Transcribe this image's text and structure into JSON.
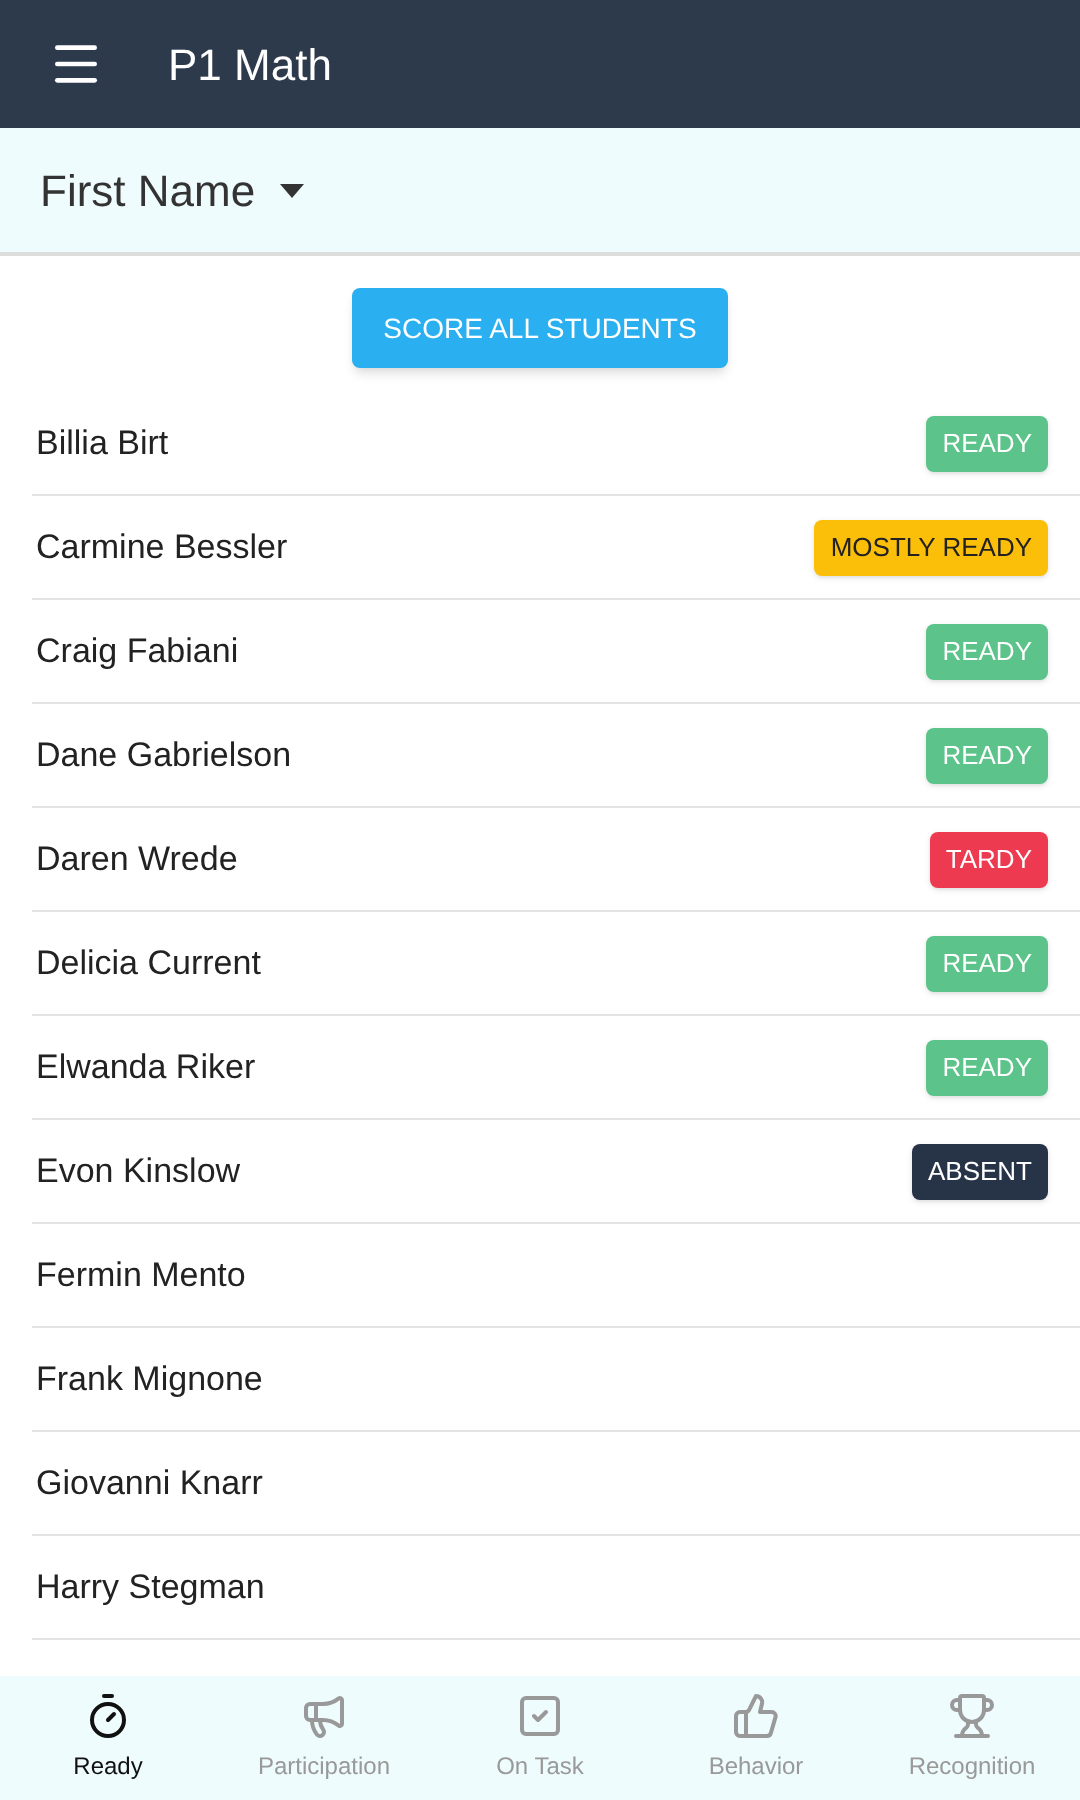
{
  "app_bar": {
    "title": "P1 Math"
  },
  "sort": {
    "label": "First Name"
  },
  "score_button": "SCORE ALL STUDENTS",
  "students": [
    {
      "name": "Billia Birt",
      "status": {
        "label": "READY",
        "kind": "ready"
      }
    },
    {
      "name": "Carmine Bessler",
      "status": {
        "label": "MOSTLY READY",
        "kind": "mostly"
      }
    },
    {
      "name": "Craig Fabiani",
      "status": {
        "label": "READY",
        "kind": "ready"
      }
    },
    {
      "name": "Dane Gabrielson",
      "status": {
        "label": "READY",
        "kind": "ready"
      }
    },
    {
      "name": "Daren Wrede",
      "status": {
        "label": "TARDY",
        "kind": "tardy"
      }
    },
    {
      "name": "Delicia Current",
      "status": {
        "label": "READY",
        "kind": "ready"
      }
    },
    {
      "name": "Elwanda Riker",
      "status": {
        "label": "READY",
        "kind": "ready"
      }
    },
    {
      "name": "Evon Kinslow",
      "status": {
        "label": "ABSENT",
        "kind": "absent"
      }
    },
    {
      "name": "Fermin Mento"
    },
    {
      "name": "Frank Mignone"
    },
    {
      "name": "Giovanni Knarr"
    },
    {
      "name": "Harry Stegman"
    }
  ],
  "bottom_nav": [
    {
      "label": "Ready",
      "kind": "timer",
      "selected": true
    },
    {
      "label": "Participation",
      "kind": "megaphone",
      "selected": false
    },
    {
      "label": "On Task",
      "kind": "checkbox",
      "selected": false
    },
    {
      "label": "Behavior",
      "kind": "thumb",
      "selected": false
    },
    {
      "label": "Recognition",
      "kind": "trophy",
      "selected": false
    }
  ]
}
